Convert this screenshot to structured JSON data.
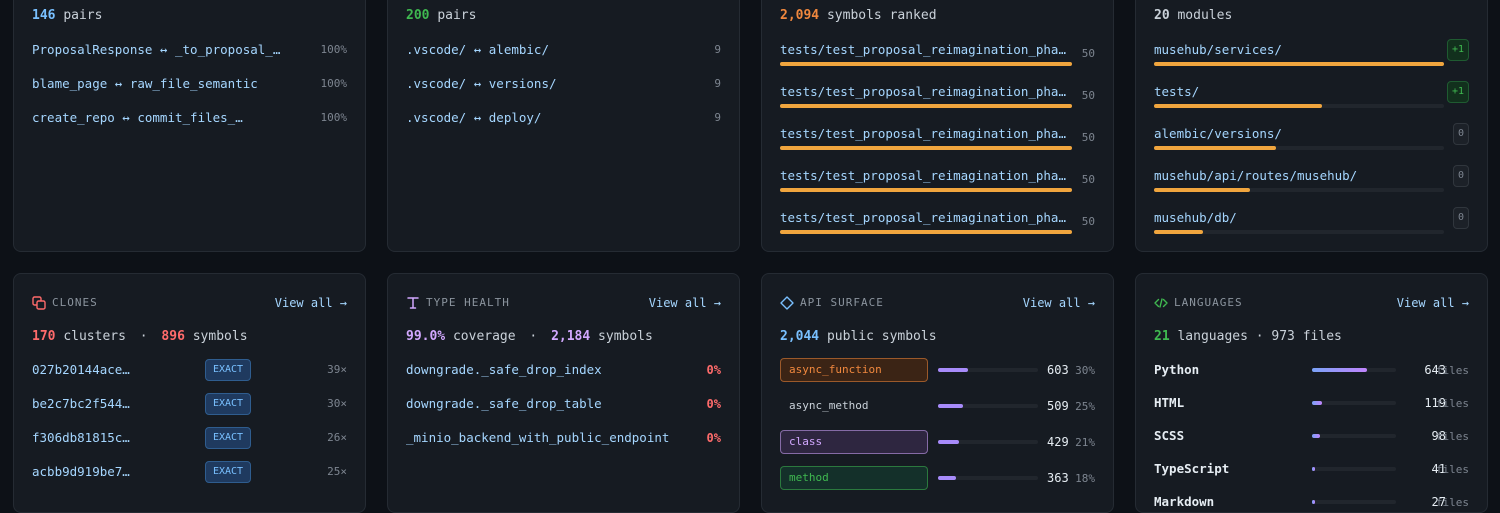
{
  "coupling": {
    "count": "146",
    "count_label": "pairs",
    "rows": [
      {
        "name": "ProposalResponse ↔ _to_proposal_…",
        "value": "100%"
      },
      {
        "name": "blame_page ↔ raw_file_semantic",
        "value": "100%"
      },
      {
        "name": "create_repo ↔ commit_files_…",
        "value": "100%"
      }
    ]
  },
  "cochange": {
    "count": "200",
    "count_label": "pairs",
    "rows": [
      {
        "name": ".vscode/ ↔ alembic/",
        "value": "9"
      },
      {
        "name": ".vscode/ ↔ versions/",
        "value": "9"
      },
      {
        "name": ".vscode/ ↔ deploy/",
        "value": "9"
      }
    ]
  },
  "ranked": {
    "count": "2,094",
    "count_label": "symbols ranked",
    "rows": [
      {
        "name": "tests/test_proposal_reimagination_pha…",
        "value": "50",
        "fraction": 1.0
      },
      {
        "name": "tests/test_proposal_reimagination_pha…",
        "value": "50",
        "fraction": 1.0
      },
      {
        "name": "tests/test_proposal_reimagination_pha…",
        "value": "50",
        "fraction": 1.0
      },
      {
        "name": "tests/test_proposal_reimagination_pha…",
        "value": "50",
        "fraction": 1.0
      },
      {
        "name": "tests/test_proposal_reimagination_pha…",
        "value": "50",
        "fraction": 1.0
      }
    ]
  },
  "modules": {
    "count": "20",
    "count_label": "modules",
    "rows": [
      {
        "name": "musehub/services/",
        "delta": "+1",
        "fraction": 1.0
      },
      {
        "name": "tests/",
        "delta": "+1",
        "fraction": 0.58
      },
      {
        "name": "alembic/versions/",
        "delta": "0",
        "fraction": 0.42
      },
      {
        "name": "musehub/api/routes/musehub/",
        "delta": "0",
        "fraction": 0.33
      },
      {
        "name": "musehub/db/",
        "delta": "0",
        "fraction": 0.17
      }
    ]
  },
  "clones": {
    "title": "CLONES",
    "view_all": "View all →",
    "clusters": "170",
    "clusters_label": "clusters",
    "sep": "·",
    "symbols": "896",
    "symbols_label": "symbols",
    "rows": [
      {
        "hash": "027b20144ace…",
        "kind": "EXACT",
        "count": "39×"
      },
      {
        "hash": "be2c7bc2f544…",
        "kind": "EXACT",
        "count": "30×"
      },
      {
        "hash": "f306db81815c…",
        "kind": "EXACT",
        "count": "26×"
      },
      {
        "hash": "acbb9d919be7…",
        "kind": "EXACT",
        "count": "25×"
      }
    ]
  },
  "type_health": {
    "title": "TYPE HEALTH",
    "view_all": "View all →",
    "coverage": "99.0%",
    "coverage_label": "coverage",
    "sep": "·",
    "symbols": "2,184",
    "symbols_label": "symbols",
    "rows": [
      {
        "name": "downgrade._safe_drop_index",
        "value": "0%"
      },
      {
        "name": "downgrade._safe_drop_table",
        "value": "0%"
      },
      {
        "name": "_minio_backend_with_public_endpoint",
        "value": "0%"
      }
    ]
  },
  "api_surface": {
    "title": "API SURFACE",
    "view_all": "View all →",
    "count": "2,044",
    "count_label": "public symbols",
    "rows": [
      {
        "kind": "async_function",
        "count": "603",
        "pct": "30%",
        "fraction": 0.3,
        "color": "#f0883e"
      },
      {
        "kind": "async_method",
        "count": "509",
        "pct": "25%",
        "fraction": 0.25,
        "color": "#c9d1d9"
      },
      {
        "kind": "class",
        "count": "429",
        "pct": "21%",
        "fraction": 0.21,
        "color": "#d2a8ff"
      },
      {
        "kind": "method",
        "count": "363",
        "pct": "18%",
        "fraction": 0.18,
        "color": "#3fb950"
      }
    ]
  },
  "languages": {
    "title": "LANGUAGES",
    "view_all": "View all →",
    "count": "21",
    "count_label": "languages · 973 files",
    "rows": [
      {
        "name": "Python",
        "files": "643",
        "unit": "files",
        "fraction": 0.66
      },
      {
        "name": "HTML",
        "files": "119",
        "unit": "files",
        "fraction": 0.12
      },
      {
        "name": "SCSS",
        "files": "98",
        "unit": "files",
        "fraction": 0.1
      },
      {
        "name": "TypeScript",
        "files": "41",
        "unit": "files",
        "fraction": 0.04
      },
      {
        "name": "Markdown",
        "files": "27",
        "unit": "files",
        "fraction": 0.03
      }
    ]
  }
}
